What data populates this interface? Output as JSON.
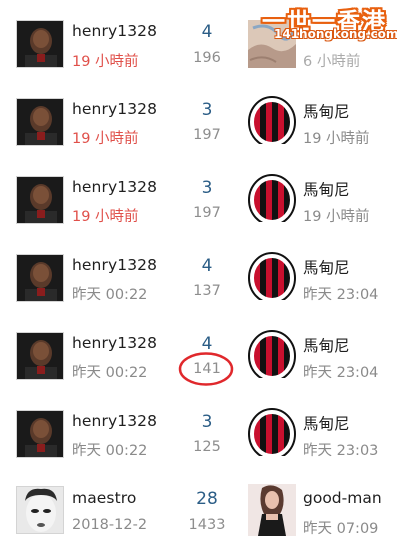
{
  "logo": {
    "main": "一世一香港",
    "sub": "141hongkong.com"
  },
  "rows": [
    {
      "user": "henry1328",
      "time": "19 小時前",
      "time_recent": true,
      "replies": "4",
      "views": "196",
      "last_user": "",
      "last_time": "6 小時前",
      "thumb": "fabric"
    },
    {
      "user": "henry1328",
      "time": "19 小時前",
      "time_recent": true,
      "replies": "3",
      "views": "197",
      "last_user": "馬甸尼",
      "last_time": "19 小時前",
      "thumb": "acmilan"
    },
    {
      "user": "henry1328",
      "time": "19 小時前",
      "time_recent": true,
      "replies": "3",
      "views": "197",
      "last_user": "馬甸尼",
      "last_time": "19 小時前",
      "thumb": "acmilan"
    },
    {
      "user": "henry1328",
      "time": "昨天 00:22",
      "time_recent": false,
      "replies": "4",
      "views": "137",
      "last_user": "馬甸尼",
      "last_time": "昨天 23:04",
      "thumb": "acmilan"
    },
    {
      "user": "henry1328",
      "time": "昨天 00:22",
      "time_recent": false,
      "replies": "4",
      "views": "141",
      "last_user": "馬甸尼",
      "last_time": "昨天 23:04",
      "thumb": "acmilan",
      "highlighted": true
    },
    {
      "user": "henry1328",
      "time": "昨天 00:22",
      "time_recent": false,
      "replies": "3",
      "views": "125",
      "last_user": "馬甸尼",
      "last_time": "昨天 23:03",
      "thumb": "acmilan"
    },
    {
      "user": "maestro",
      "time": "2018-12-2",
      "time_recent": false,
      "replies": "28",
      "views": "1433",
      "last_user": "good-man",
      "last_time": "昨天 07:09",
      "thumb": "woman"
    }
  ],
  "colors": {
    "recent_time": "#e0504a",
    "reply_count": "#2b5d86",
    "milan_red": "#c8102e",
    "highlight_circle": "#e0282c"
  },
  "icons": {
    "avatar_1": "henry-avatar",
    "avatar_2": "maestro-avatar"
  }
}
